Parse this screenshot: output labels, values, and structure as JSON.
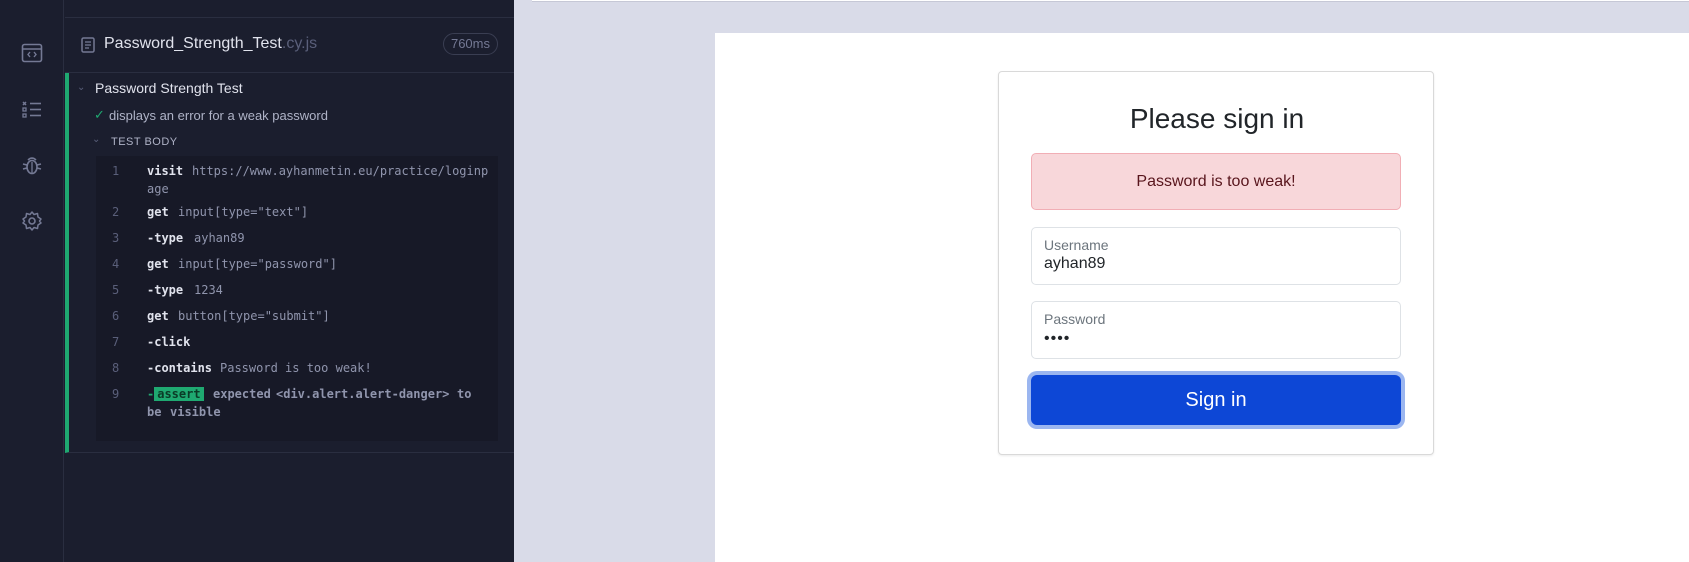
{
  "rail": {
    "icons": [
      "specs-icon",
      "runs-icon",
      "debug-icon",
      "settings-icon"
    ]
  },
  "spec": {
    "name": "Password_Strength_Test",
    "ext": ".cy.js",
    "duration": "760ms"
  },
  "suite": {
    "title": "Password Strength Test",
    "test_title": "displays an error for a weak password",
    "body_label": "TEST BODY",
    "commands": [
      {
        "num": "1",
        "name": "visit",
        "msg": "https://www.ayhanmetin.eu/practice/loginp",
        "msg2": "age"
      },
      {
        "num": "2",
        "name": "get",
        "msg": "input[type=\"text\"]"
      },
      {
        "num": "3",
        "name": "-type",
        "msg": "ayhan89"
      },
      {
        "num": "4",
        "name": "get",
        "msg": "input[type=\"password\"]"
      },
      {
        "num": "5",
        "name": "-type",
        "msg": "1234"
      },
      {
        "num": "6",
        "name": "get",
        "msg": "button[type=\"submit\"]"
      },
      {
        "num": "7",
        "name": "-click",
        "msg": ""
      },
      {
        "num": "8",
        "name": "-contains",
        "msg": "Password is too weak!"
      },
      {
        "num": "9",
        "name": "-",
        "badge": "assert",
        "msg": "expected",
        "selector": "<div.alert.alert-danger>",
        "to": "to",
        "msg2_a": "be",
        "msg2_b": "visible"
      }
    ]
  },
  "app": {
    "heading": "Please sign in",
    "alert": "Password is too weak!",
    "username_label": "Username",
    "username_value": "ayhan89",
    "password_label": "Password",
    "password_value": "••••",
    "submit": "Sign in"
  }
}
